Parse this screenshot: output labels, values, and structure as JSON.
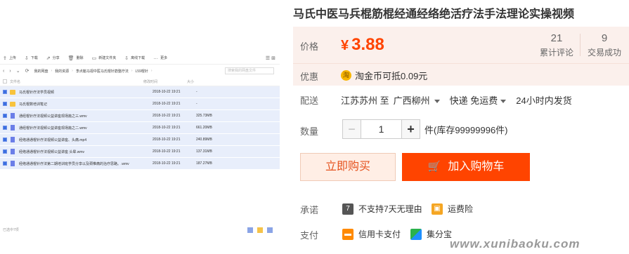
{
  "cloud": {
    "toolbar": [
      {
        "icon": "⇪",
        "label": "上传"
      },
      {
        "icon": "⇩",
        "label": "下载"
      },
      {
        "icon": "⇗",
        "label": "分享"
      },
      {
        "icon": "🗑",
        "label": "删除"
      },
      {
        "icon": "▭",
        "label": "新建文件夹"
      },
      {
        "icon": "⇩",
        "label": "离线下载"
      },
      {
        "icon": "…",
        "label": "更多"
      }
    ],
    "breadcrumbs": [
      "我的网盘",
      "我的资源",
      "李点魁马视中医马氏棍针筋整疗法",
      "L59棍针"
    ],
    "search_placeholder": "搜索我的网盘文件",
    "headers": {
      "name": "文件名",
      "date": "修改时间",
      "size": "大小"
    },
    "rows": [
      {
        "type": "folder",
        "name": "马氏棍针疗法学员视频",
        "date": "2018-10-22 19:21",
        "size": "-"
      },
      {
        "type": "folder",
        "name": "马氏棍数培训笔记",
        "date": "2018-10-22 19:21",
        "size": "-"
      },
      {
        "type": "file",
        "name": "通经棍针疗法视频公益讲座现场篇之三.wmv",
        "date": "2018-10-22 19:21",
        "size": "325.73MB"
      },
      {
        "type": "file",
        "name": "通经棍针疗法视频公益讲座现场篇之二.wmv",
        "date": "2018-10-22 19:21",
        "size": "661.20MB"
      },
      {
        "type": "file",
        "name": "经络通通棍针疗法视频公益讲座、头痛.mp4",
        "date": "2018-10-22 19:21",
        "size": "240.89MB"
      },
      {
        "type": "file",
        "name": "经络通通棍针疗法视频公益讲座 头晕.wmv",
        "date": "2018-10-22 19:21",
        "size": "137.31MB"
      },
      {
        "type": "file",
        "name": "经络通通棍针疗法第二期培训班学员分享以及颈椎痛的治疗思路。.wmv",
        "date": "2018-10-22 19:21",
        "size": "187.27MB"
      }
    ],
    "footer": "已选中7项"
  },
  "product": {
    "title": "马氏中医马兵棍筋棍经通经络绝活疗法手法理论实操视频",
    "price_label": "价格",
    "currency": "¥",
    "price": "3.88",
    "reviews_count": "21",
    "reviews_label": "累计评论",
    "deals_count": "9",
    "deals_label": "交易成功",
    "coupon_label": "优惠",
    "coupon_icon": "淘",
    "coupon_text": "淘金币可抵0.09元",
    "ship_label": "配送",
    "ship_from": "江苏苏州 至",
    "ship_to": "广西柳州",
    "ship_method": "快递 免运费",
    "ship_time": "24小时内发货",
    "qty_label": "数量",
    "qty_minus": "−",
    "qty_value": "1",
    "qty_plus": "+",
    "stock": "件(库存99999996件)",
    "buy_now": "立即购买",
    "add_cart": "加入购物车",
    "promise_label": "承诺",
    "promise_icon": "7",
    "promise_text": "不支持7天无理由",
    "insurance_text": "运费险",
    "pay_label": "支付",
    "pay_card": "信用卡支付",
    "pay_jifen": "集分宝",
    "colors": {
      "price": "#ff4400",
      "cart": "#ff4400"
    }
  },
  "watermark": "www.xunibaoku.com"
}
